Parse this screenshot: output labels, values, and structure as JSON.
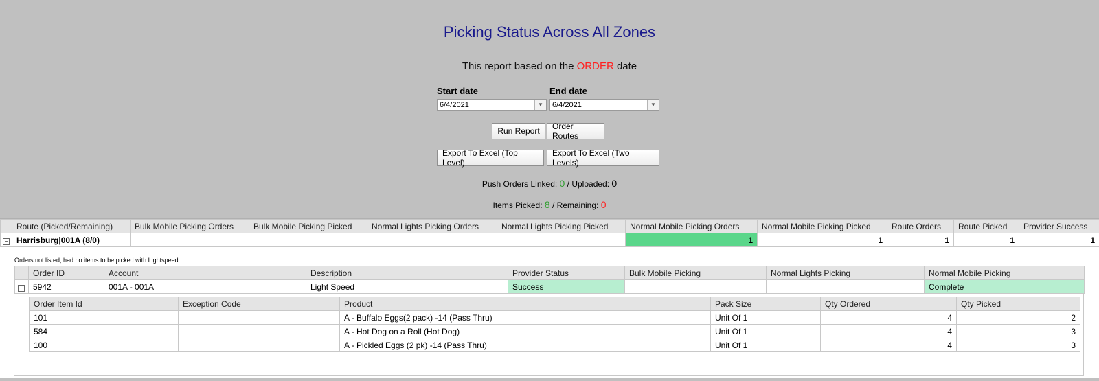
{
  "page": {
    "title": "Picking Status Across All Zones",
    "subtitle_prefix": "This report based on the ",
    "subtitle_highlight": "ORDER",
    "subtitle_suffix": " date"
  },
  "filters": {
    "start_label": "Start date",
    "start_value": "6/4/2021",
    "end_label": "End date",
    "end_value": "6/4/2021"
  },
  "buttons": {
    "run_report": "Run Report",
    "order_routes": "Order Routes",
    "export_top": "Export To Excel (Top Level)",
    "export_two": "Export To Excel (Two Levels)"
  },
  "stats": {
    "push_label": "Push Orders Linked: ",
    "push_linked": "0",
    "uploaded_label": " / Uploaded: ",
    "uploaded": "0",
    "items_label": "Items Picked: ",
    "items_picked": "8",
    "remaining_label": " / Remaining: ",
    "remaining": "0"
  },
  "colors": {
    "highlight_green": "#5ad68a",
    "light_green": "#b7eed0",
    "title_blue": "#1a1a8c",
    "red": "#ff2020",
    "green_text": "#2e9e2e"
  },
  "route_table": {
    "headers": [
      "Route (Picked/Remaining)",
      "Bulk Mobile Picking Orders",
      "Bulk Mobile Picking Picked",
      "Normal Lights Picking Orders",
      "Normal Lights Picking Picked",
      "Normal Mobile Picking Orders",
      "Normal Mobile Picking Picked",
      "Route Orders",
      "Route Picked",
      "Provider Success"
    ],
    "row": {
      "route": "Harrisburg|001A (8/0)",
      "bulk_orders": "",
      "bulk_picked": "",
      "lights_orders": "",
      "lights_picked": "",
      "mobile_orders": "1",
      "mobile_picked": "1",
      "route_orders": "1",
      "route_picked": "1",
      "provider_success": "1"
    }
  },
  "orders_note": "Orders not listed, had no items to be picked with Lightspeed",
  "order_table": {
    "headers": [
      "Order ID",
      "Account",
      "Description",
      "Provider Status",
      "Bulk Mobile Picking",
      "Normal Lights Picking",
      "Normal Mobile Picking"
    ],
    "row": {
      "order_id": "5942",
      "account": "001A - 001A",
      "description": "Light Speed",
      "provider_status": "Success",
      "bulk_mobile": "",
      "normal_lights": "",
      "normal_mobile": "Complete"
    }
  },
  "item_table": {
    "headers": [
      "Order Item Id",
      "Exception Code",
      "Product",
      "Pack Size",
      "Qty Ordered",
      "Qty Picked"
    ],
    "rows": [
      {
        "id": "101",
        "exception": "",
        "product": "A - Buffalo Eggs(2 pack) -14 (Pass Thru)",
        "pack": "Unit Of 1",
        "ordered": "4",
        "picked": "2"
      },
      {
        "id": "584",
        "exception": "",
        "product": "A - Hot Dog on a Roll (Hot Dog)",
        "pack": "Unit Of 1",
        "ordered": "4",
        "picked": "3"
      },
      {
        "id": "100",
        "exception": "",
        "product": "A - Pickled Eggs (2 pk) -14 (Pass Thru)",
        "pack": "Unit Of 1",
        "ordered": "4",
        "picked": "3"
      }
    ]
  }
}
